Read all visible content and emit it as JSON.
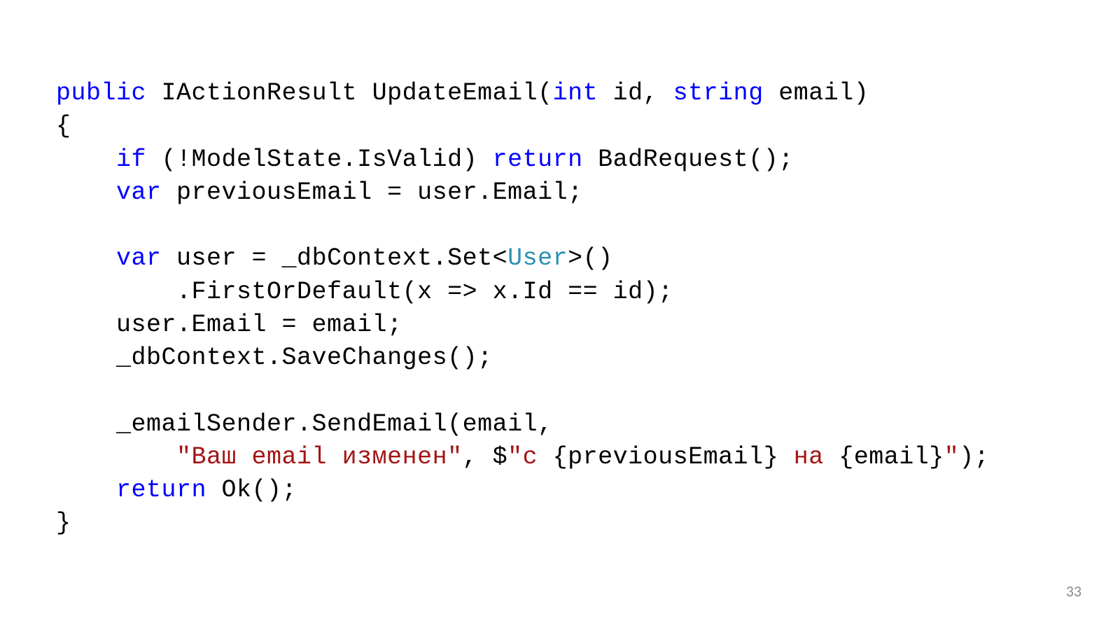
{
  "code": {
    "tokens": [
      {
        "t": "public",
        "c": "kw"
      },
      {
        "t": " IActionResult UpdateEmail("
      },
      {
        "t": "int",
        "c": "kw"
      },
      {
        "t": " id, "
      },
      {
        "t": "string",
        "c": "kw"
      },
      {
        "t": " email)\n"
      },
      {
        "t": "{\n"
      },
      {
        "t": "    "
      },
      {
        "t": "if",
        "c": "kw"
      },
      {
        "t": " (!ModelState.IsValid) "
      },
      {
        "t": "return",
        "c": "kw"
      },
      {
        "t": " BadRequest();\n"
      },
      {
        "t": "    "
      },
      {
        "t": "var",
        "c": "kw"
      },
      {
        "t": " previousEmail = user.Email;\n"
      },
      {
        "t": "\n"
      },
      {
        "t": "    "
      },
      {
        "t": "var",
        "c": "kw"
      },
      {
        "t": " user = _dbContext.Set<"
      },
      {
        "t": "User",
        "c": "type"
      },
      {
        "t": ">()\n"
      },
      {
        "t": "        .FirstOrDefault(x => x.Id == id);\n"
      },
      {
        "t": "    user.Email = email;\n"
      },
      {
        "t": "    _dbContext.SaveChanges();\n"
      },
      {
        "t": "\n"
      },
      {
        "t": "    _emailSender.SendEmail(email,\n"
      },
      {
        "t": "        "
      },
      {
        "t": "\"Ваш email изменен\"",
        "c": "str"
      },
      {
        "t": ", $"
      },
      {
        "t": "\"с ",
        "c": "str"
      },
      {
        "t": "{previousEmail}"
      },
      {
        "t": " на ",
        "c": "str"
      },
      {
        "t": "{email}"
      },
      {
        "t": "\"",
        "c": "str"
      },
      {
        "t": ");\n"
      },
      {
        "t": "    "
      },
      {
        "t": "return",
        "c": "kw"
      },
      {
        "t": " Ok();\n"
      },
      {
        "t": "}"
      }
    ]
  },
  "page_number": "33"
}
